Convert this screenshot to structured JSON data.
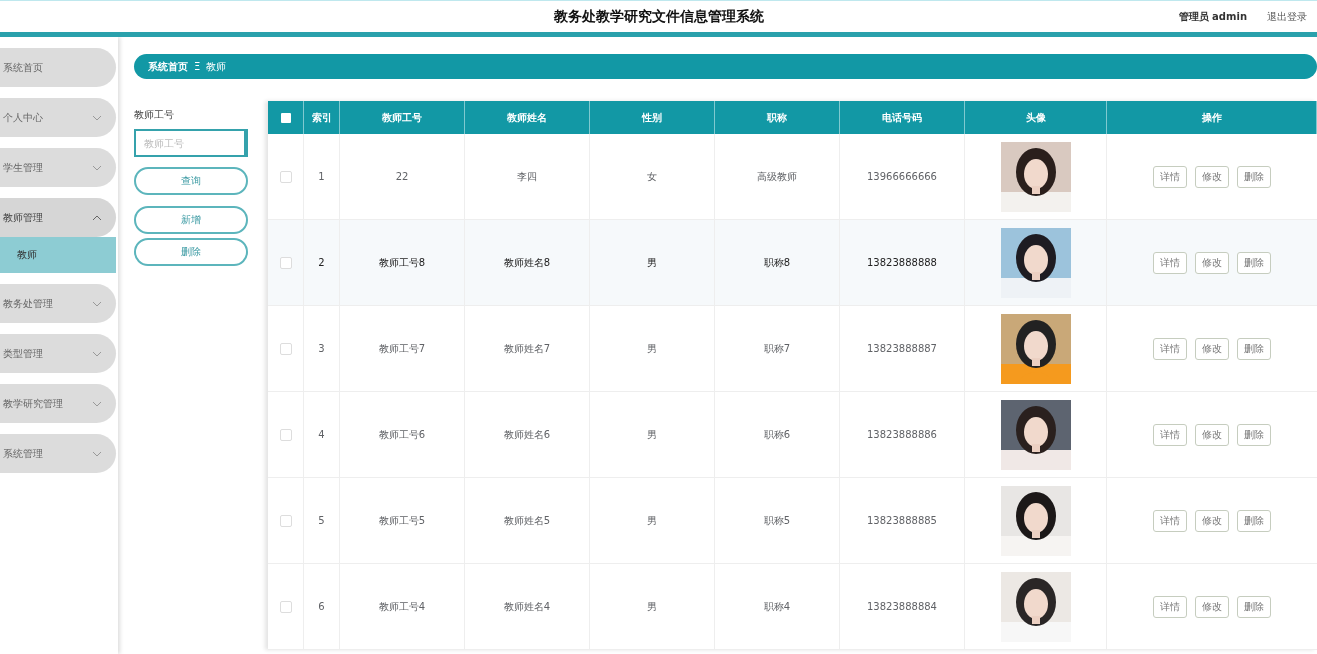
{
  "header": {
    "title": "教务处教学研究文件信息管理系统",
    "user": "管理员 admin",
    "logout": "退出登录"
  },
  "sidebar": {
    "items": [
      {
        "label": "系统首页"
      },
      {
        "label": "个人中心",
        "expanded": false
      },
      {
        "label": "学生管理",
        "expanded": false
      },
      {
        "label": "教师管理",
        "expanded": true,
        "children": [
          {
            "label": "教师",
            "selected": true
          }
        ]
      },
      {
        "label": "教务处管理",
        "expanded": false
      },
      {
        "label": "类型管理",
        "expanded": false
      },
      {
        "label": "教学研究管理",
        "expanded": false
      },
      {
        "label": "系统管理",
        "expanded": false
      }
    ]
  },
  "breadcrumb": {
    "home": "系统首页",
    "separator": "Ξ",
    "current": "教师"
  },
  "filter": {
    "label": "教师工号",
    "placeholder": "教师工号",
    "buttons": [
      "查询",
      "新增",
      "删除"
    ]
  },
  "table": {
    "all_checked": false,
    "columns": [
      "索引",
      "教师工号",
      "教师姓名",
      "性别",
      "职称",
      "电话号码",
      "头像",
      "操作"
    ],
    "rows": [
      {
        "index": "1",
        "id": "22",
        "name": "李四",
        "gender": "女",
        "title": "高级教师",
        "phone": "13966666666",
        "checked": false,
        "hovered": false,
        "actions": [
          "详情",
          "修改",
          "删除"
        ]
      },
      {
        "index": "2",
        "id": "教师工号8",
        "name": "教师姓名8",
        "gender": "男",
        "title": "职称8",
        "phone": "13823888888",
        "checked": false,
        "hovered": true,
        "actions": [
          "详情",
          "修改",
          "删除"
        ]
      },
      {
        "index": "3",
        "id": "教师工号7",
        "name": "教师姓名7",
        "gender": "男",
        "title": "职称7",
        "phone": "13823888887",
        "checked": false,
        "hovered": false,
        "actions": [
          "详情",
          "修改",
          "删除"
        ]
      },
      {
        "index": "4",
        "id": "教师工号6",
        "name": "教师姓名6",
        "gender": "男",
        "title": "职称6",
        "phone": "13823888886",
        "checked": false,
        "hovered": false,
        "actions": [
          "详情",
          "修改",
          "删除"
        ]
      },
      {
        "index": "5",
        "id": "教师工号5",
        "name": "教师姓名5",
        "gender": "男",
        "title": "职称5",
        "phone": "13823888885",
        "checked": false,
        "hovered": false,
        "actions": [
          "详情",
          "修改",
          "删除"
        ]
      },
      {
        "index": "6",
        "id": "教师工号4",
        "name": "教师姓名4",
        "gender": "男",
        "title": "职称4",
        "phone": "13823888884",
        "checked": false,
        "hovered": false,
        "actions": [
          "详情",
          "修改",
          "删除"
        ]
      }
    ]
  }
}
